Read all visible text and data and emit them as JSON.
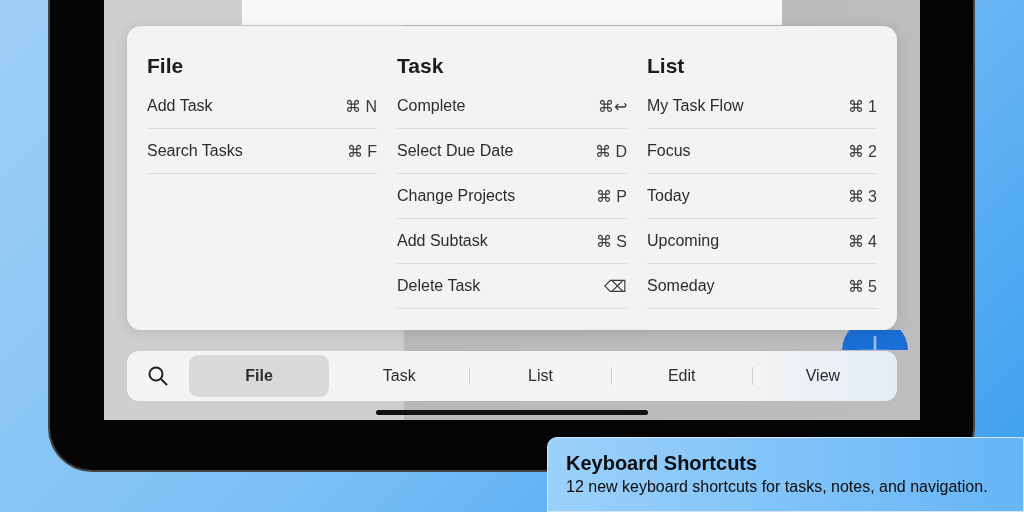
{
  "menu": {
    "columns": [
      {
        "title": "File",
        "items": [
          {
            "label": "Add Task",
            "shortcut": "⌘ N"
          },
          {
            "label": "Search Tasks",
            "shortcut": "⌘ F"
          }
        ]
      },
      {
        "title": "Task",
        "items": [
          {
            "label": "Complete",
            "shortcut": "⌘↩"
          },
          {
            "label": "Select Due Date",
            "shortcut": "⌘ D"
          },
          {
            "label": "Change Projects",
            "shortcut": "⌘ P"
          },
          {
            "label": "Add Subtask",
            "shortcut": "⌘ S"
          },
          {
            "label": "Delete Task",
            "shortcut": "⌫"
          }
        ]
      },
      {
        "title": "List",
        "items": [
          {
            "label": "My Task Flow",
            "shortcut": "⌘ 1"
          },
          {
            "label": "Focus",
            "shortcut": "⌘ 2"
          },
          {
            "label": "Today",
            "shortcut": "⌘ 3"
          },
          {
            "label": "Upcoming",
            "shortcut": "⌘ 4"
          },
          {
            "label": "Someday",
            "shortcut": "⌘ 5"
          }
        ]
      }
    ]
  },
  "tab_bar": {
    "tabs": [
      {
        "label": "File",
        "selected": true
      },
      {
        "label": "Task",
        "selected": false
      },
      {
        "label": "List",
        "selected": false
      },
      {
        "label": "Edit",
        "selected": false
      },
      {
        "label": "View",
        "selected": false
      }
    ]
  },
  "caption": {
    "title": "Keyboard Shortcuts",
    "text": "12 new keyboard shortcuts for tasks, notes, and navigation."
  }
}
